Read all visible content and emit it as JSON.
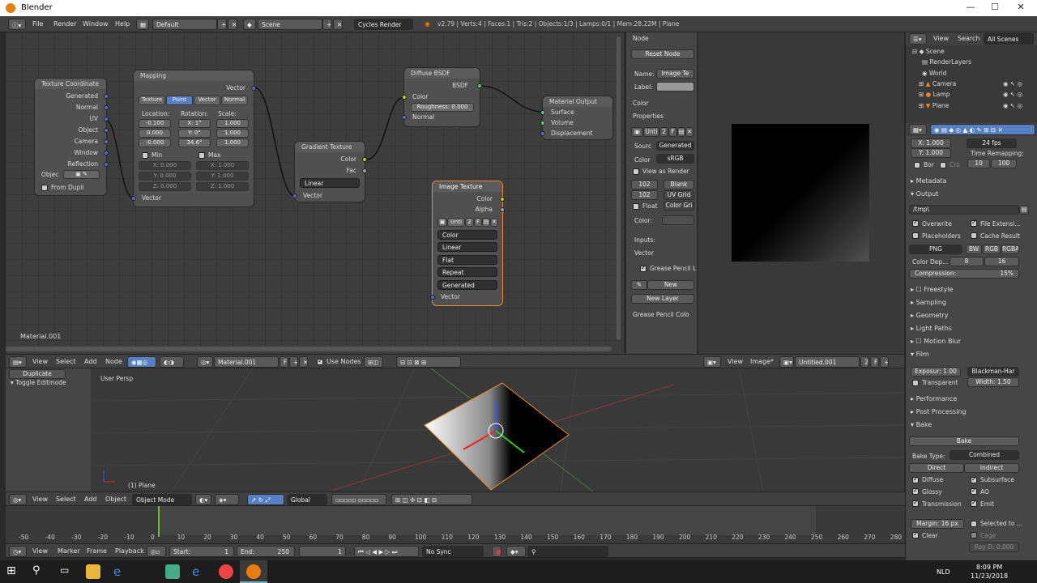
{
  "window": {
    "title": "Blender",
    "minimize": "—",
    "maximize": "☐",
    "close": "✕"
  },
  "infobar": {
    "menus": [
      "File",
      "Render",
      "Window",
      "Help"
    ],
    "layout": "Default",
    "scene": "Scene",
    "engine": "Cycles Render",
    "stats": "v2.79 | Verts:4 | Faces:1 | Tris:2 | Objects:1/3 | Lamps:0/1 | Mem:28.22M | Plane"
  },
  "nodes": {
    "texcoord": {
      "title": "Texture Coordinate",
      "outputs": [
        "Generated",
        "Normal",
        "UV",
        "Object",
        "Camera",
        "Window",
        "Reflection"
      ],
      "object_label": "Objec",
      "from_dupli": "From Dupli"
    },
    "mapping": {
      "title": "Mapping",
      "out": "Vector",
      "tabs": [
        "Texture",
        "Point",
        "Vector",
        "Normal"
      ],
      "loc_label": "Location:",
      "rot_label": "Rotation:",
      "scale_label": "Scale:",
      "loc": [
        "-0.100",
        "0.000",
        "-0.000"
      ],
      "rot": [
        "X:  1°",
        "Y:  0°",
        "34.6°"
      ],
      "scale": [
        "1.000",
        "1.000",
        "1.000"
      ],
      "min": "Min",
      "max": "Max",
      "min_vals": [
        "X:        0.000",
        "Y:        0.000",
        "Z:        0.000"
      ],
      "max_vals": [
        "X:        1.000",
        "Y:        1.000",
        "Z:        1.000"
      ],
      "in": "Vector"
    },
    "gradient": {
      "title": "Gradient Texture",
      "outs": [
        "Color",
        "Fac"
      ],
      "type": "Linear",
      "in": "Vector"
    },
    "diffuse": {
      "title": "Diffuse BSDF",
      "out": "BSDF",
      "color": "Color",
      "roughness": "Roughness:  0.000",
      "normal": "Normal"
    },
    "matout": {
      "title": "Material Output",
      "ins": [
        "Surface",
        "Volume",
        "Displacement"
      ]
    },
    "imgtex": {
      "title": "Image Texture",
      "outs": [
        "Color",
        "Alpha"
      ],
      "img": "Unti",
      "users": "2",
      "f": "F",
      "opts": [
        "Color",
        "Linear",
        "Flat",
        "Repeat",
        "Generated"
      ],
      "in": "Vector"
    }
  },
  "nodeeditor": {
    "material_label": "Material.001",
    "header": {
      "menus": [
        "View",
        "Select",
        "Add",
        "Node"
      ],
      "material": "Material.001",
      "f": "F",
      "use_nodes": "Use Nodes"
    }
  },
  "npanel": {
    "node_hdr": "Node",
    "reset": "Reset Node",
    "name_lbl": "Name:",
    "name_val": "Image Te",
    "label_lbl": "Label:",
    "color_hdr": "Color",
    "props_hdr": "Properties",
    "img": "Unti",
    "users": "2",
    "f": "F",
    "source_lbl": "Sourc",
    "source_val": "Generated",
    "color_lbl": "Color",
    "color_val": "sRGB",
    "view_render": "View as Render",
    "w": "102",
    "h": "102",
    "gen": [
      "Blank",
      "UV Grid",
      "Color Gri"
    ],
    "float": "Float",
    "color2": "Color:",
    "inputs": "Inputs:",
    "vector": "Vector",
    "gp_hdr": "Grease Pencil L",
    "new": "New",
    "new_layer": "New Layer",
    "gp_color": "Grease Pencil Colo"
  },
  "imageeditor": {
    "menus": [
      "View",
      "Image*"
    ],
    "image": "Untitled.001",
    "users": "2",
    "f": "F"
  },
  "outliner": {
    "menus": [
      "View",
      "Search"
    ],
    "filter": "All Scenes",
    "items": [
      "Scene",
      "RenderLayers",
      "World",
      "Camera",
      "Lamp",
      "Plane"
    ]
  },
  "props": {
    "res": {
      "x": "X:            1.000",
      "y": "Y:            1.000",
      "fps": "24 fps",
      "remap": "Time Remapping:",
      "r1": "10",
      "r2": "100",
      "bor": "Bor",
      "cro": "Cro"
    },
    "metadata": "Metadata",
    "output": "Output",
    "path": "/tmp\\",
    "overwrite": "Overwrite",
    "file_ext": "File Extensi...",
    "placeholders": "Placeholders",
    "cache": "Cache Result",
    "format": "PNG",
    "bw": "BW",
    "rgb": "RGB",
    "rgba": "RGBA",
    "depth_lbl": "Color Dep...",
    "d8": "8",
    "d16": "16",
    "compression": "Compression:",
    "comp_val": "15%",
    "sections": [
      "Freestyle",
      "Sampling",
      "Geometry",
      "Light Paths",
      "Motion Blur",
      "Film"
    ],
    "film": {
      "exposure": "Exposur: 1.00",
      "filter": "Blackman-Har",
      "transparent": "Transparent",
      "width": "Width:  1.50"
    },
    "perf": "Performance",
    "post": "Post Processing",
    "bake_hdr": "Bake",
    "bake_btn": "Bake",
    "bake_type_lbl": "Bake Type:",
    "bake_type": "Combined",
    "direct": "Direct",
    "indirect": "Indirect",
    "passes_l": [
      "Diffuse",
      "Glossy",
      "Transmission"
    ],
    "passes_r": [
      "Subsurface",
      "AO",
      "Emit"
    ],
    "margin": "Margin: 16 px",
    "selected_to": "Selected to ...",
    "clear": "Clear",
    "cage": "Cage",
    "ray": "Ray D: 0.000"
  },
  "toolshelf": {
    "duplicate": "Duplicate",
    "toggle": "Toggle Editmode"
  },
  "view3d": {
    "persp": "User Persp",
    "obj": "(1) Plane",
    "header": {
      "menus": [
        "View",
        "Select",
        "Add",
        "Object"
      ],
      "mode": "Object Mode",
      "orient": "Global"
    }
  },
  "timeline": {
    "ticks": [
      "-50",
      "-40",
      "-30",
      "-20",
      "-10",
      "0",
      "10",
      "20",
      "30",
      "40",
      "50",
      "60",
      "70",
      "80",
      "90",
      "100",
      "110",
      "120",
      "130",
      "140",
      "150",
      "160",
      "170",
      "180",
      "190",
      "200",
      "210",
      "220",
      "230",
      "240",
      "250",
      "260",
      "270",
      "280"
    ],
    "menus": [
      "View",
      "Marker",
      "Frame",
      "Playback"
    ],
    "start": "Start:",
    "start_v": "1",
    "end": "End:",
    "end_v": "250",
    "cur": "1",
    "sync": "No Sync"
  },
  "taskbar": {
    "time": "8:09 PM",
    "date": "11/23/2018",
    "lang": "NLD"
  }
}
